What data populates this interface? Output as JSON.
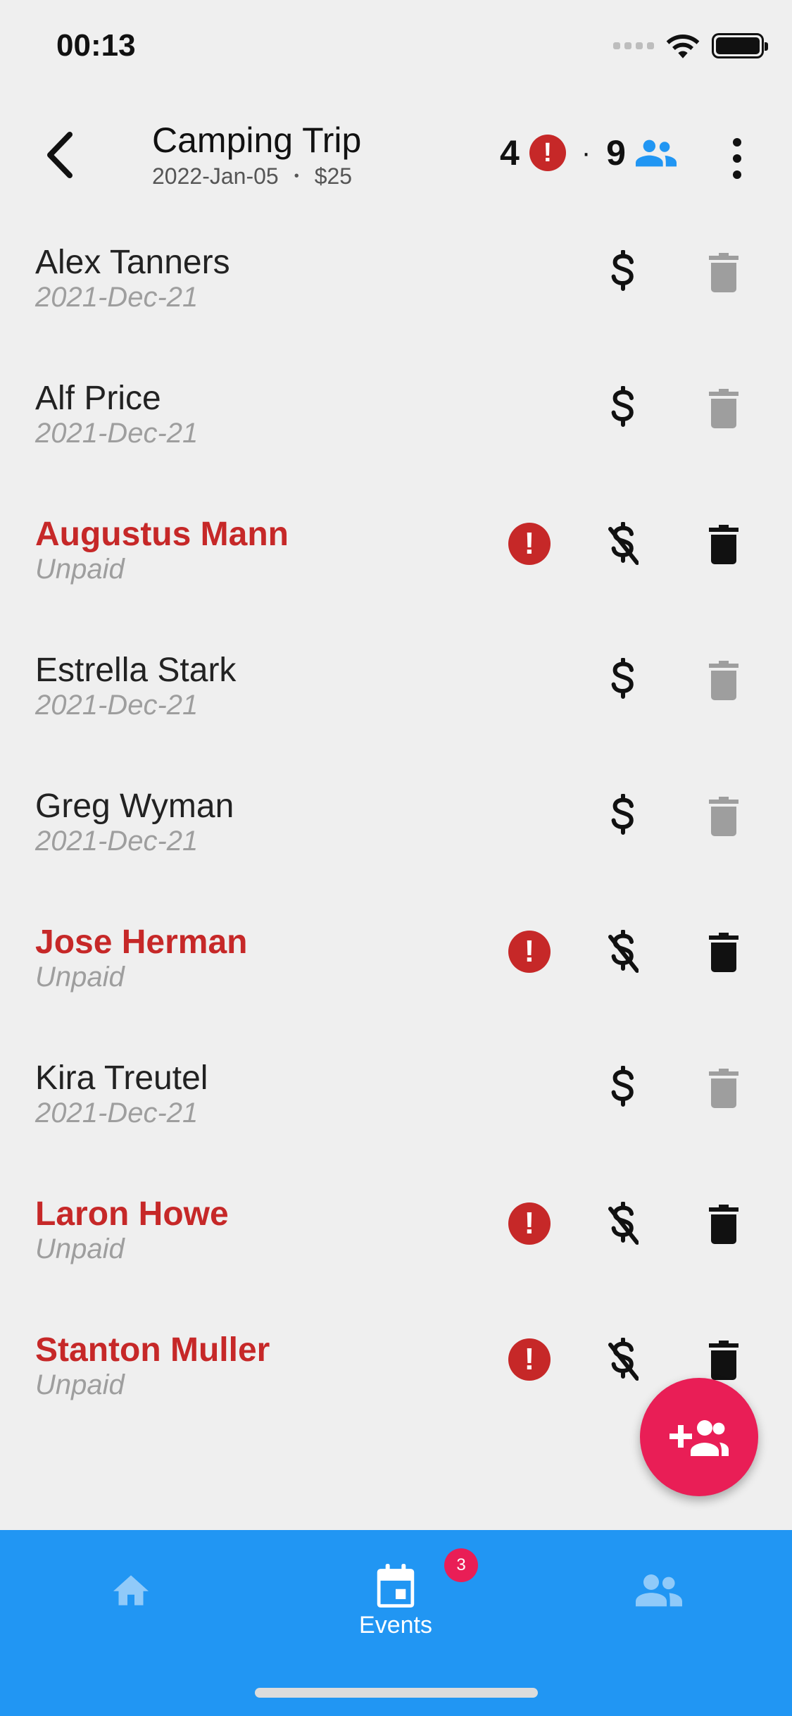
{
  "status_bar": {
    "time": "00:13"
  },
  "header": {
    "title": "Camping Trip",
    "date": "2022-Jan-05",
    "separator": "•",
    "price": "$25",
    "unpaid_count": "4",
    "warn_symbol": "!",
    "count_separator": "·",
    "member_count": "9"
  },
  "attendees": [
    {
      "name": "Alex Tanners",
      "status": "2021-Dec-21",
      "paid": true
    },
    {
      "name": "Alf Price",
      "status": "2021-Dec-21",
      "paid": true
    },
    {
      "name": "Augustus Mann",
      "status": "Unpaid",
      "paid": false
    },
    {
      "name": "Estrella Stark",
      "status": "2021-Dec-21",
      "paid": true
    },
    {
      "name": "Greg Wyman",
      "status": "2021-Dec-21",
      "paid": true
    },
    {
      "name": "Jose Herman",
      "status": "Unpaid",
      "paid": false
    },
    {
      "name": "Kira Treutel",
      "status": "2021-Dec-21",
      "paid": true
    },
    {
      "name": "Laron Howe",
      "status": "Unpaid",
      "paid": false
    },
    {
      "name": "Stanton Muller",
      "status": "Unpaid",
      "paid": false
    }
  ],
  "bottom_nav": {
    "home_icon": "home-icon",
    "events_label": "Events",
    "events_badge": "3",
    "groups_icon": "groups-icon"
  },
  "colors": {
    "accent": "#2196f3",
    "warning": "#c62828",
    "fab": "#e91e56",
    "disabled": "#9e9e9e"
  }
}
